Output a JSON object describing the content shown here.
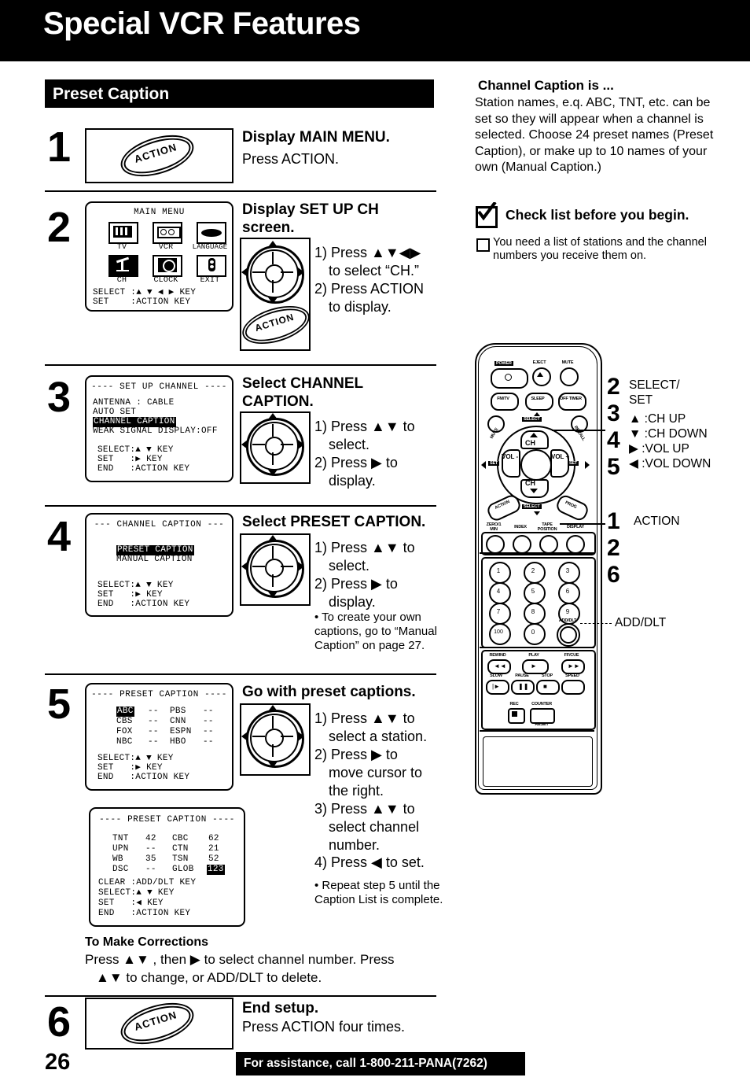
{
  "header": {
    "title": "Special VCR Features"
  },
  "section": {
    "bar_label": "Preset Caption"
  },
  "steps": [
    {
      "number": "1",
      "heading": "Display MAIN MENU.",
      "body": "Press ACTION.",
      "button_label": "ACTION"
    },
    {
      "number": "2",
      "heading_line1": "Display SET UP CH",
      "heading_line2": "screen.",
      "instr1": "1) Press ▲▼◀▶",
      "instr1b": "to select “CH.”",
      "instr2": "2) Press ACTION",
      "instr2b": "to display.",
      "button_label": "ACTION",
      "osd": {
        "title": "MAIN MENU",
        "icons": [
          {
            "label": "TV",
            "selected": false
          },
          {
            "label": "VCR",
            "selected": false
          },
          {
            "label": "LANGUAGE",
            "selected": false
          },
          {
            "label": "CH",
            "selected": true
          },
          {
            "label": "CLOCK",
            "selected": false
          },
          {
            "label": "EXIT",
            "selected": false
          }
        ],
        "footer": [
          "SELECT :▲ ▼ ◀ ▶ KEY",
          "SET    :ACTION KEY"
        ]
      }
    },
    {
      "number": "3",
      "heading_line1": "Select CHANNEL",
      "heading_line2": "CAPTION.",
      "instr1": "1) Press ▲▼ to",
      "instr1b": "select.",
      "instr2": "2) Press ▶ to",
      "instr2b": "display.",
      "osd": {
        "title": "---- SET UP CHANNEL ----",
        "lines": [
          {
            "text": "ANTENNA : CABLE",
            "highlight": false
          },
          {
            "text": "AUTO SET",
            "highlight": false
          },
          {
            "text": "CHANNEL CAPTION",
            "highlight": true
          },
          {
            "text": "WEAK SIGNAL DISPLAY:OFF",
            "highlight": false
          }
        ],
        "footer": [
          "SELECT:▲ ▼ KEY",
          "SET   :▶ KEY",
          "END   :ACTION KEY"
        ]
      }
    },
    {
      "number": "4",
      "heading_line1": "Select PRESET CAPTION.",
      "instr1": "1) Press ▲▼ to",
      "instr1b": "select.",
      "instr2": "2) Press ▶ to",
      "instr2b": "display.",
      "note": "• To create your own captions, go to “Manual Caption” on page 27.",
      "osd": {
        "title": "--- CHANNEL CAPTION ---",
        "lines": [
          {
            "text": "PRESET CAPTION",
            "highlight": true
          },
          {
            "text": "MANUAL CAPTION",
            "highlight": false
          }
        ],
        "footer": [
          "SELECT:▲ ▼ KEY",
          "SET   :▶ KEY",
          "END   :ACTION KEY"
        ]
      }
    },
    {
      "number": "5",
      "heading_line1": "Go with preset captions.",
      "instr1": "1) Press ▲▼ to",
      "instr1b": "select a station.",
      "instr2": "2) Press ▶ to",
      "instr2b": "move cursor to",
      "instr2c": "the right.",
      "instr3": "3) Press ▲▼ to",
      "instr3b": "select channel",
      "instr3c": "number.",
      "instr4": "4) Press ◀ to set.",
      "note": "• Repeat step 5 until the Caption List is complete.",
      "osd1": {
        "title": "---- PRESET CAPTION ----",
        "rows": [
          {
            "name": "ABC",
            "val": "--",
            "name2": "PBS",
            "val2": "--",
            "highlight_name": true
          },
          {
            "name": "CBS",
            "val": "--",
            "name2": "CNN",
            "val2": "--",
            "highlight_name": false
          },
          {
            "name": "FOX",
            "val": "--",
            "name2": "ESPN",
            "val2": "--",
            "highlight_name": false
          },
          {
            "name": "NBC",
            "val": "--",
            "name2": "HBO",
            "val2": "--",
            "highlight_name": false
          }
        ],
        "footer": [
          "SELECT:▲ ▼ KEY",
          "SET   :▶ KEY",
          "END   :ACTION KEY"
        ]
      },
      "osd2": {
        "title": "---- PRESET CAPTION ----",
        "rows": [
          {
            "name": "TNT",
            "val": "42",
            "name2": "CBC",
            "val2": "62",
            "highlight_val2": false
          },
          {
            "name": "UPN",
            "val": "--",
            "name2": "CTN",
            "val2": "21",
            "highlight_val2": false
          },
          {
            "name": "WB",
            "val": "35",
            "name2": "TSN",
            "val2": "52",
            "highlight_val2": false
          },
          {
            "name": "DSC",
            "val": "--",
            "name2": "GLOB",
            "val2": "123",
            "highlight_val2": true
          }
        ],
        "footer": [
          "CLEAR :ADD/DLT KEY",
          "SELECT:▲ ▼ KEY",
          "SET   :◀ KEY",
          "END   :ACTION KEY"
        ]
      }
    },
    {
      "number": "6",
      "heading": "End setup.",
      "body": "Press ACTION four times.",
      "button_label": "ACTION"
    }
  ],
  "corrections": {
    "heading": "To Make Corrections",
    "line1": "Press ▲▼ , then ▶ to select channel number. Press",
    "line2": "▲▼ to change, or ADD/DLT to delete."
  },
  "right": {
    "heading": "Channel Caption is ...",
    "body": "Station names, e.q. ABC, TNT, etc. can be set so they will appear when a channel is selected. Choose 24 preset names (Preset Caption), or make up to 10 names of your own (Manual Caption.)",
    "check_heading": "Check list before you begin.",
    "check_item": "You need a list of stations and the channel numbers you receive them on."
  },
  "remote": {
    "buttons_row1": [
      "POWER",
      "EJECT",
      "MUTE"
    ],
    "buttons_row2": [
      "FM/TV",
      "SLEEP",
      "OFF TIMER"
    ],
    "pad": {
      "center_top": "CH",
      "center_bottom": "CH",
      "left": "VOL -",
      "right": "VOL +",
      "select_top": "SELECT",
      "select_bottom": "SELECT",
      "set_left": "SET",
      "set_right": "SET",
      "corner_left": "MUTE",
      "corner_right": "RECALL",
      "action": "ACTION",
      "prog": "PROG"
    },
    "func_row": [
      "ZERO/1 MIN",
      "INDEX",
      "TAPE POSITION",
      "DISPLAY"
    ],
    "keypad": [
      "1",
      "2",
      "3",
      "4",
      "5",
      "6",
      "7",
      "8",
      "9",
      "100",
      "0",
      "ADD/DLT"
    ],
    "transport_top": [
      "REWIND",
      "PLAY",
      "FF/CUE"
    ],
    "transport_bottom": [
      "SLOW",
      "PAUSE",
      "STOP",
      "SPEED"
    ],
    "rec": "REC",
    "counter": "COUNTER",
    "counter2": "RESET"
  },
  "callouts": {
    "group1_nums": [
      "2",
      "3",
      "4",
      "5"
    ],
    "group1_title_l1": "SELECT/",
    "group1_title_l2": "SET",
    "group1_lines": [
      "▲ :CH UP",
      "▼ :CH DOWN",
      "▶ :VOL UP",
      "◀ :VOL DOWN"
    ],
    "group2_nums": [
      "1",
      "2",
      "6"
    ],
    "group2_label": "ACTION",
    "group3_label": "ADD/DLT"
  },
  "footer": {
    "page_number": "26",
    "assistance": "For assistance, call 1-800-211-PANA(7262)"
  }
}
